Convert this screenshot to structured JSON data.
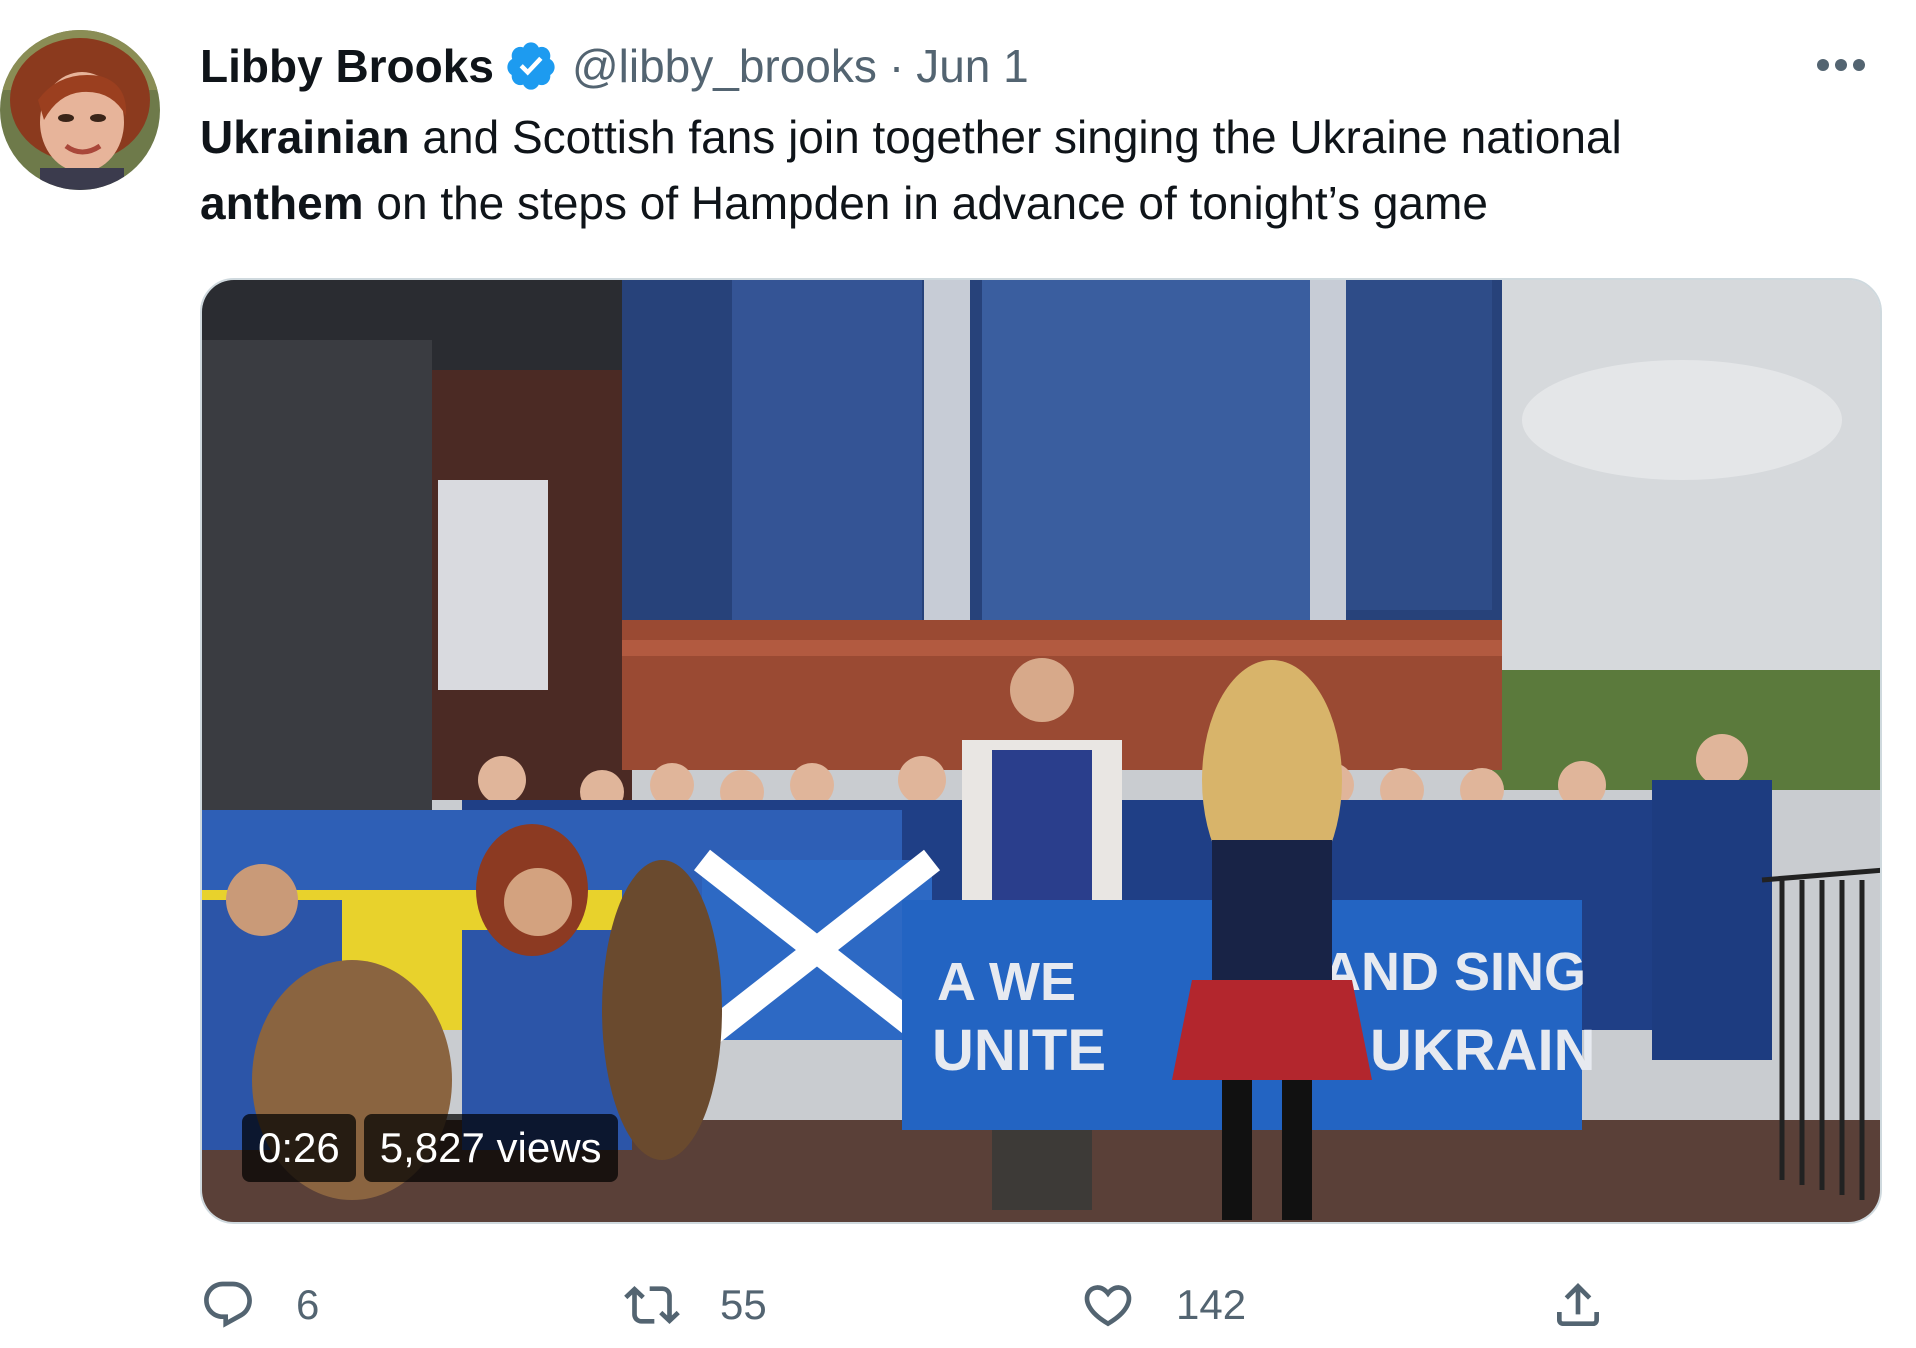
{
  "author": {
    "display_name": "Libby Brooks",
    "handle": "@libby_brooks",
    "separator": "·",
    "date": "Jun 1",
    "verified": true
  },
  "tweet": {
    "text_parts": [
      {
        "text": "Ukrainian",
        "bold": true
      },
      {
        "text": " and Scottish fans join together singing the Ukraine national ",
        "bold": false
      },
      {
        "text": "anthem",
        "bold": true
      },
      {
        "text": " on the steps of Hampden in advance of tonight’s game",
        "bold": false
      }
    ]
  },
  "media": {
    "type": "video",
    "duration": "0:26",
    "views": "5,827 views",
    "banner_text_line1": "A WE",
    "banner_text_line1b": "AND SING",
    "banner_text_line2": "UNITE",
    "banner_text_line2b": "H UKRAIN"
  },
  "actions": {
    "reply_count": "6",
    "retweet_count": "55",
    "like_count": "142"
  },
  "icons": {
    "verified": "verified-badge-icon",
    "more": "more-icon",
    "reply": "reply-icon",
    "retweet": "retweet-icon",
    "like": "heart-icon",
    "share": "share-icon"
  },
  "colors": {
    "verified_blue": "#1d9bf0",
    "secondary_text": "#536471",
    "primary_text": "#0f1419"
  }
}
